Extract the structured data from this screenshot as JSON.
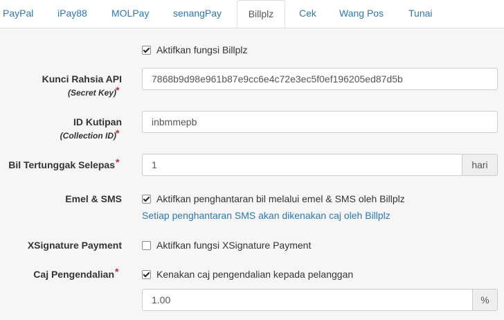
{
  "tabs": [
    {
      "label": "PayPal"
    },
    {
      "label": "iPay88"
    },
    {
      "label": "MOLPay"
    },
    {
      "label": "senangPay"
    },
    {
      "label": "Billplz",
      "active": true
    },
    {
      "label": "Cek"
    },
    {
      "label": "Wang Pos"
    },
    {
      "label": "Tunai"
    }
  ],
  "form": {
    "enable": {
      "checked": true,
      "label": "Aktifkan fungsi Billplz"
    },
    "secret_key": {
      "label": "Kunci Rahsia API",
      "sublabel": "(Secret Key)",
      "required": "*",
      "value": "7868b9d98e961b87e9cc6e4c72e3ec5f0ef196205ed87d5b"
    },
    "collection_id": {
      "label": "ID Kutipan",
      "sublabel": "(Collection ID)",
      "required": "*",
      "value": "inbmmepb"
    },
    "overdue": {
      "label": "Bil Tertunggak Selepas",
      "required": "*",
      "value": "1",
      "addon": "hari"
    },
    "email_sms": {
      "label": "Emel & SMS",
      "checked": true,
      "checkbox_label": "Aktifkan penghantaran bil melalui emel & SMS oleh Billplz",
      "help": "Setiap penghantaran SMS akan dikenakan caj oleh Billplz"
    },
    "xsignature": {
      "label": "XSignature Payment",
      "checked": false,
      "checkbox_label": "Aktifkan fungsi XSignature Payment"
    },
    "handling_fee": {
      "label": "Caj Pengendalian",
      "required": "*",
      "checked": true,
      "checkbox_label": "Kenakan caj pengendalian kepada pelanggan",
      "value": "1.00",
      "addon": "%"
    }
  },
  "colors": {
    "link": "#2a78b6",
    "required": "#b03040",
    "background": "#f6f6f6"
  }
}
